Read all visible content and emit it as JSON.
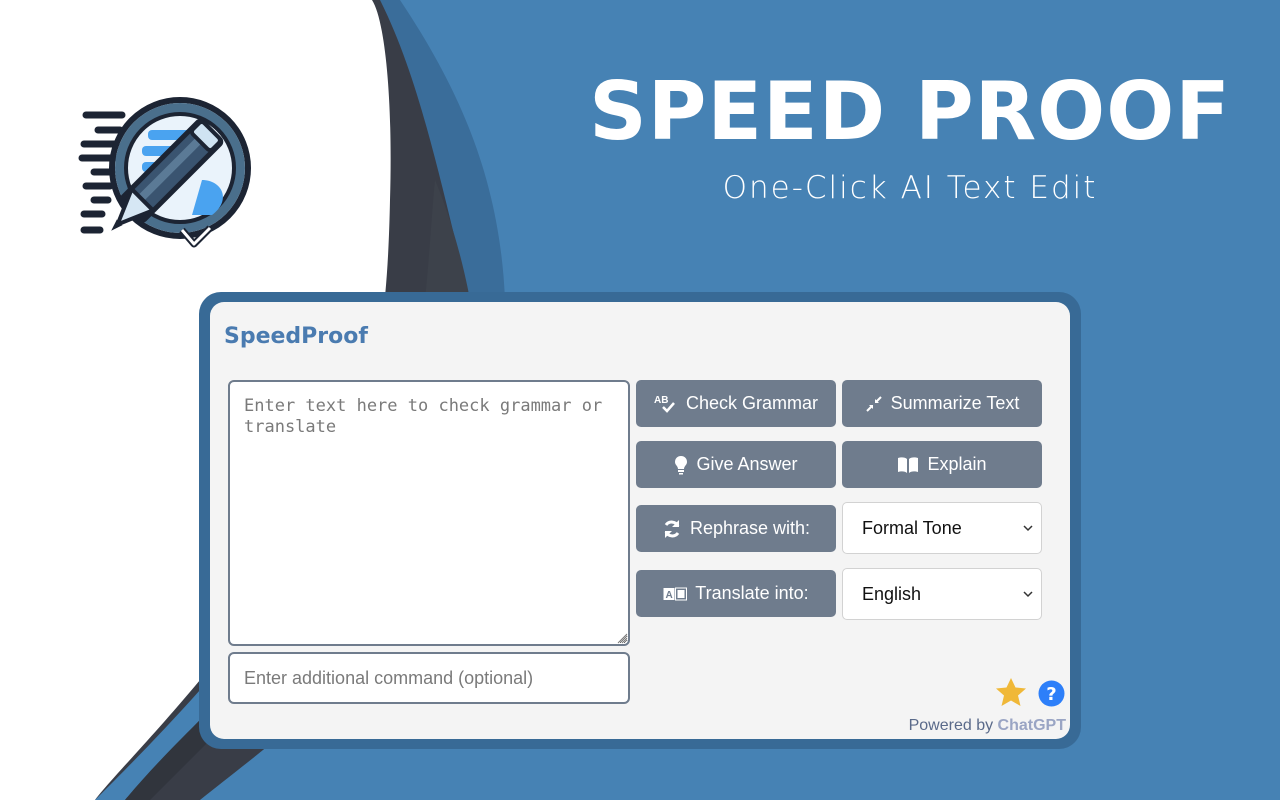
{
  "hero": {
    "title": "SPEED PROOF",
    "subtitle": "One-Click AI Text Edit"
  },
  "logo": {
    "icon": "pencil-check-speech-bubble-icon"
  },
  "colors": {
    "background": "#4682b4",
    "panel_frame": "#386a96",
    "panel": "#f4f4f4",
    "button": "#6f7c8d",
    "title_accent": "#4a7bb0",
    "star": "#f0b838",
    "help": "#2d7ff9"
  },
  "popup": {
    "title": "SpeedProof",
    "main_text": {
      "value": "",
      "placeholder": "Enter text here to check grammar or translate"
    },
    "command_input": {
      "value": "",
      "placeholder": "Enter additional command (optional)"
    },
    "buttons": {
      "check_grammar": {
        "label": "Check Grammar",
        "icon": "spellcheck-icon"
      },
      "summarize": {
        "label": "Summarize Text",
        "icon": "compress-arrows-icon"
      },
      "give_answer": {
        "label": "Give Answer",
        "icon": "lightbulb-icon"
      },
      "explain": {
        "label": "Explain",
        "icon": "book-icon"
      },
      "rephrase": {
        "label": "Rephrase with:",
        "icon": "sync-icon"
      },
      "translate": {
        "label": "Translate into:",
        "icon": "translate-icon"
      }
    },
    "rephrase_select": {
      "selected": "Formal Tone"
    },
    "translate_select": {
      "selected": "English"
    },
    "footer": {
      "powered_prefix": "Powered by ",
      "powered_brand": "ChatGPT",
      "star_icon": "star-icon",
      "help_icon": "help-icon"
    }
  }
}
